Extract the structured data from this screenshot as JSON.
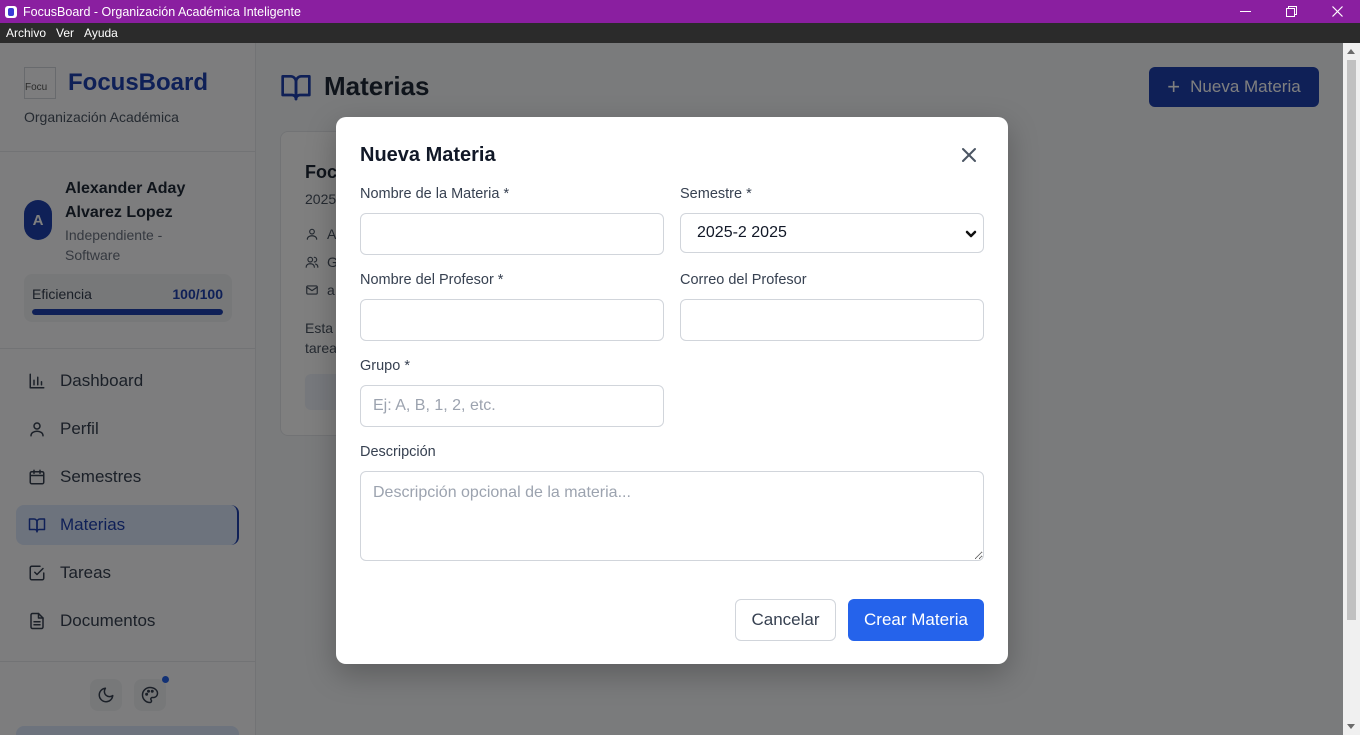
{
  "window": {
    "title": "FocusBoard - Organización Académica Inteligente",
    "menu": [
      "Archivo",
      "Ver",
      "Ayuda"
    ]
  },
  "sidebar": {
    "logo_alt": "Focu",
    "brand": "FocusBoard",
    "subtitle": "Organización Académica",
    "user": {
      "initial": "A",
      "name": "Alexander Aday Alvarez Lopez",
      "org": "Independiente - Software"
    },
    "efficiency": {
      "label": "Eficiencia",
      "value": "100/100",
      "fraction": 1.0
    },
    "nav": [
      {
        "label": "Dashboard",
        "icon": "bar-chart-icon"
      },
      {
        "label": "Perfil",
        "icon": "user-icon"
      },
      {
        "label": "Semestres",
        "icon": "calendar-icon"
      },
      {
        "label": "Materias",
        "icon": "book-open-icon",
        "active": true
      },
      {
        "label": "Tareas",
        "icon": "check-square-icon"
      },
      {
        "label": "Documentos",
        "icon": "file-text-icon"
      }
    ]
  },
  "main": {
    "title": "Materias",
    "new_button": "Nueva Materia",
    "card": {
      "title": "Foc",
      "sub": "2025",
      "row1": "A",
      "row2": "G",
      "row3": "a",
      "desc_line1": "Esta",
      "desc_line2": "tarea"
    }
  },
  "modal": {
    "title": "Nueva Materia",
    "name_label": "Nombre de la Materia *",
    "name_value": "",
    "semester_label": "Semestre *",
    "semester_value": "2025-2 2025",
    "professor_label": "Nombre del Profesor *",
    "professor_value": "",
    "email_label": "Correo del Profesor",
    "email_value": "",
    "group_label": "Grupo *",
    "group_placeholder": "Ej: A, B, 1, 2, etc.",
    "desc_label": "Descripción",
    "desc_placeholder": "Descripción opcional de la materia...",
    "cancel": "Cancelar",
    "create": "Crear Materia"
  },
  "colors": {
    "titlebar": "#8a1fa0",
    "primary": "#1e40af",
    "button": "#2563eb"
  }
}
